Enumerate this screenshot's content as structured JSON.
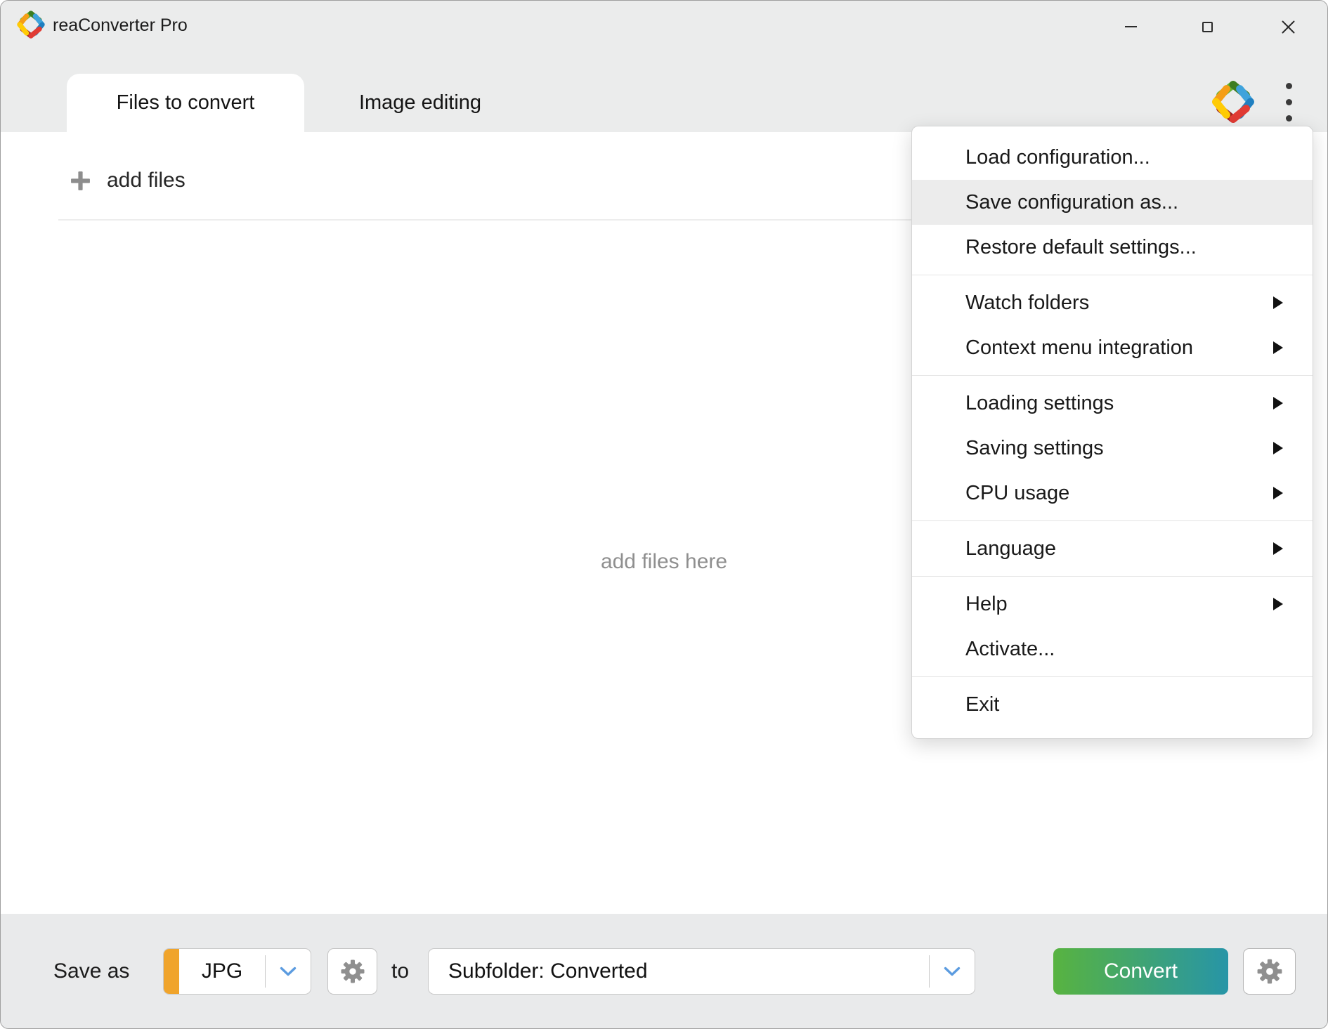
{
  "window": {
    "title": "reaConverter Pro"
  },
  "tabs": [
    {
      "label": "Files to convert",
      "active": true
    },
    {
      "label": "Image editing",
      "active": false
    }
  ],
  "file_list": {
    "add_files_label": "add files",
    "empty_placeholder": "add files here"
  },
  "menu": {
    "groups": [
      [
        {
          "label": "Load configuration...",
          "slug": "load-configuration",
          "submenu": false,
          "highlighted": false
        },
        {
          "label": "Save configuration as...",
          "slug": "save-configuration-as",
          "submenu": false,
          "highlighted": true
        },
        {
          "label": "Restore default settings...",
          "slug": "restore-default-settings",
          "submenu": false,
          "highlighted": false
        }
      ],
      [
        {
          "label": "Watch folders",
          "slug": "watch-folders",
          "submenu": true,
          "highlighted": false
        },
        {
          "label": "Context menu integration",
          "slug": "context-menu-integration",
          "submenu": true,
          "highlighted": false
        }
      ],
      [
        {
          "label": "Loading settings",
          "slug": "loading-settings",
          "submenu": true,
          "highlighted": false
        },
        {
          "label": "Saving settings",
          "slug": "saving-settings",
          "submenu": true,
          "highlighted": false
        },
        {
          "label": "CPU usage",
          "slug": "cpu-usage",
          "submenu": true,
          "highlighted": false
        }
      ],
      [
        {
          "label": "Language",
          "slug": "language",
          "submenu": true,
          "highlighted": false
        }
      ],
      [
        {
          "label": "Help",
          "slug": "help",
          "submenu": true,
          "highlighted": false
        },
        {
          "label": "Activate...",
          "slug": "activate",
          "submenu": false,
          "highlighted": false
        }
      ],
      [
        {
          "label": "Exit",
          "slug": "exit",
          "submenu": false,
          "highlighted": false
        }
      ]
    ]
  },
  "bottom_bar": {
    "save_as_label": "Save as",
    "format_value": "JPG",
    "to_label": "to",
    "destination_value": "Subfolder: Converted",
    "convert_label": "Convert"
  },
  "icons": {
    "logo": "reaconverter-pinwheel-logo",
    "kebab": "kebab-menu-icon",
    "plus": "plus-icon",
    "gear": "gear-icon",
    "chevron": "chevron-down-icon",
    "submenu_arrow": "submenu-arrow-icon"
  },
  "colors": {
    "accent-orange": "#f0a42b",
    "chevron-blue": "#5c9ce0",
    "convert-from": "#58b340",
    "convert-to": "#2795a7",
    "highlight": "#ececec",
    "logo-light-green": "#65b32e",
    "logo-dark-green": "#3c7d20",
    "logo-light-blue": "#3fa3dc",
    "logo-dark-blue": "#1f7fc0",
    "logo-red": "#e13b34",
    "logo-dark-red": "#9e2123",
    "logo-yellow": "#ffcb05",
    "logo-orange": "#f59e16"
  }
}
